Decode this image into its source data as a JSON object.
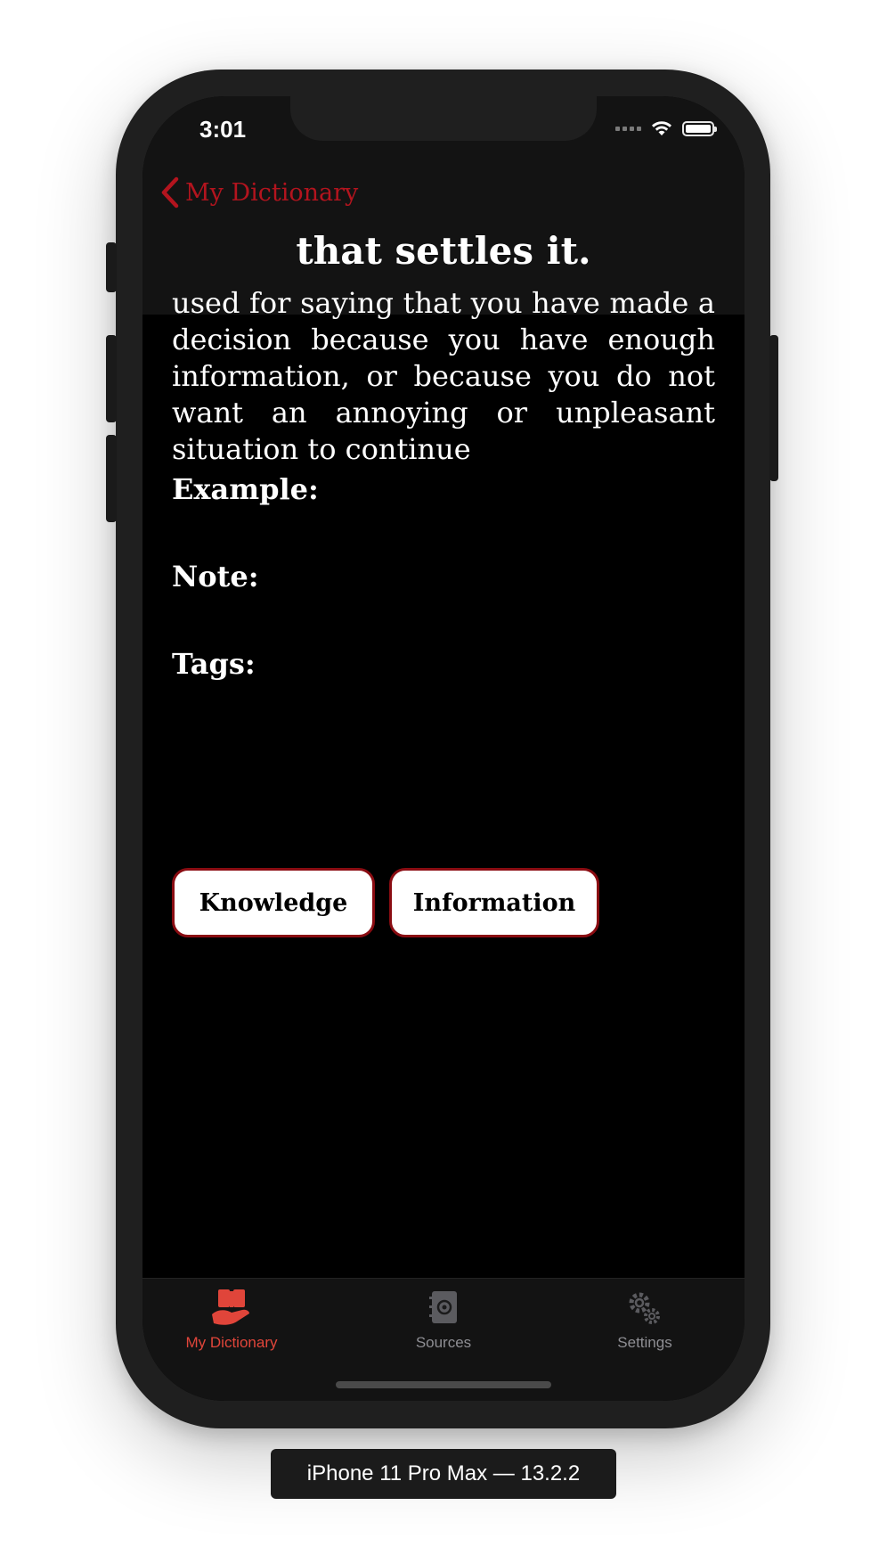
{
  "status_bar": {
    "time": "3:01"
  },
  "nav": {
    "back_label": "My Dictionary"
  },
  "entry": {
    "term": "that settles it.",
    "definition": "used for saying that you have made a decision because you have enough information, or because you do not want an annoying or unpleasant situation to continue",
    "example_label": "Example:",
    "note_label": "Note:",
    "tags_label": "Tags:",
    "tags": [
      "Knowledge",
      "Information"
    ]
  },
  "tab_bar": {
    "tabs": [
      {
        "label": "My Dictionary",
        "icon": "hand-book-icon",
        "active": true
      },
      {
        "label": "Sources",
        "icon": "address-book-icon",
        "active": false
      },
      {
        "label": "Settings",
        "icon": "gears-icon",
        "active": false
      }
    ]
  },
  "device": {
    "label": "iPhone 11 Pro Max — 13.2.2"
  },
  "colors": {
    "accent": "#b3141e",
    "active_tab": "#e0453a",
    "inactive_tab": "#8e8e93",
    "tag_border": "#8a0c12"
  }
}
